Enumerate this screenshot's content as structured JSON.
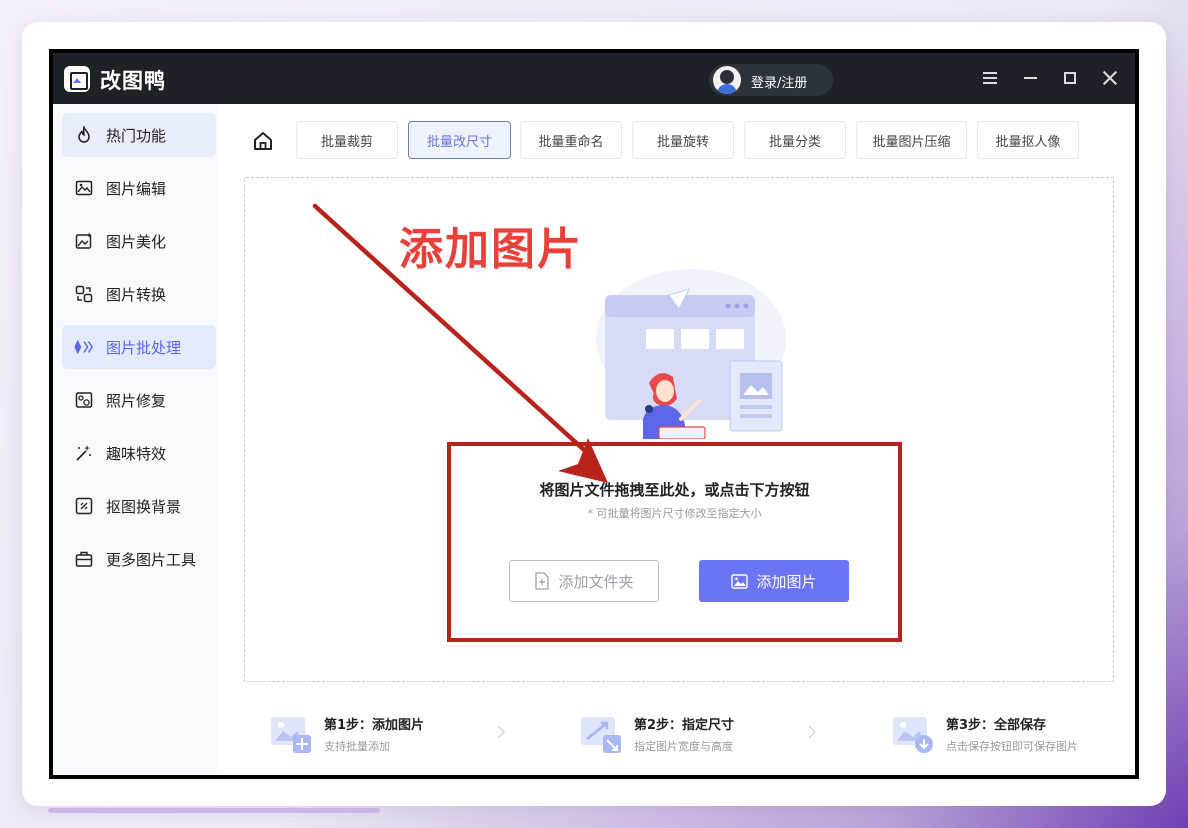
{
  "app": {
    "name": "改图鸭",
    "login_label": "登录/注册"
  },
  "sidebar": {
    "items": [
      {
        "label": "热门功能",
        "icon": "flame-icon"
      },
      {
        "label": "图片编辑",
        "icon": "image-edit-icon"
      },
      {
        "label": "图片美化",
        "icon": "sparkle-image-icon"
      },
      {
        "label": "图片转换",
        "icon": "convert-icon"
      },
      {
        "label": "图片批处理",
        "icon": "batch-icon"
      },
      {
        "label": "照片修复",
        "icon": "photo-repair-icon"
      },
      {
        "label": "趣味特效",
        "icon": "magic-wand-icon"
      },
      {
        "label": "抠图换背景",
        "icon": "cutout-icon"
      },
      {
        "label": "更多图片工具",
        "icon": "toolbox-icon"
      }
    ],
    "active_index": 4
  },
  "tabs": {
    "items": [
      {
        "label": "批量裁剪"
      },
      {
        "label": "批量改尺寸"
      },
      {
        "label": "批量重命名"
      },
      {
        "label": "批量旋转"
      },
      {
        "label": "批量分类"
      },
      {
        "label": "批量图片压缩"
      },
      {
        "label": "批量抠人像"
      }
    ],
    "active_index": 1
  },
  "annotation": {
    "title": "添加图片",
    "color": "#e8413a"
  },
  "dropzone": {
    "hint": "将图片文件拖拽至此处，或点击下方按钮",
    "sub_hint": "* 可批量将图片尺寸修改至指定大小",
    "add_folder_label": "添加文件夹",
    "add_image_label": "添加图片"
  },
  "steps": [
    {
      "title": "第1步：添加图片",
      "desc": "支持批量添加"
    },
    {
      "title": "第2步：指定尺寸",
      "desc": "指定图片宽度与高度"
    },
    {
      "title": "第3步：全部保存",
      "desc": "点击保存按钮即可保存图片"
    }
  ],
  "colors": {
    "accent": "#6a74f5",
    "titlebar": "#1e2227",
    "highlight_box": "#b8231c"
  }
}
